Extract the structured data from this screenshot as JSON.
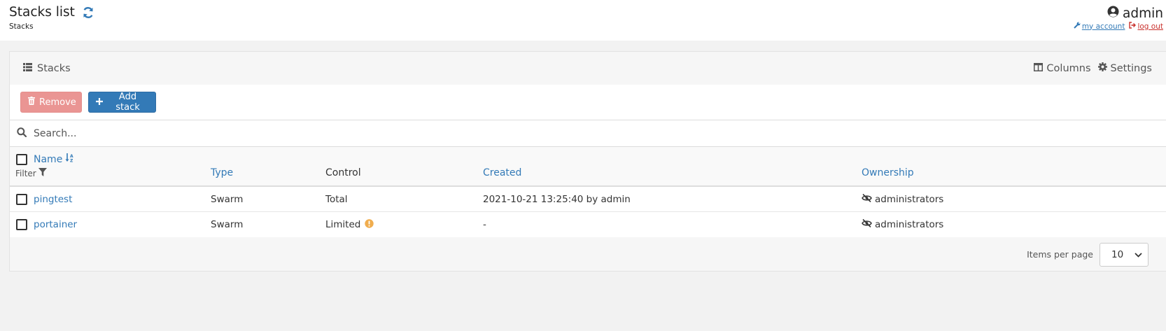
{
  "header": {
    "title": "Stacks list",
    "breadcrumb": "Stacks",
    "user": "admin",
    "my_account": "my account",
    "log_out": "log out"
  },
  "widget": {
    "title": "Stacks",
    "columns_label": "Columns",
    "settings_label": "Settings"
  },
  "toolbar": {
    "remove_label": "Remove",
    "add_label": "Add stack"
  },
  "search": {
    "placeholder": "Search..."
  },
  "table": {
    "columns": {
      "name": "Name",
      "filter": "Filter",
      "type": "Type",
      "control": "Control",
      "created": "Created",
      "ownership": "Ownership"
    },
    "rows": [
      {
        "name": "pingtest",
        "type": "Swarm",
        "control": "Total",
        "created": "2021-10-21 13:25:40 by admin",
        "ownership": "administrators"
      },
      {
        "name": "portainer",
        "type": "Swarm",
        "control": "Limited",
        "created": "-",
        "ownership": "administrators"
      }
    ]
  },
  "pagination": {
    "items_per_page_label": "Items per page",
    "items_per_page_value": "10"
  },
  "colors": {
    "accent": "#337ab7",
    "danger_light": "#ea9593",
    "warning": "#f0ad4e",
    "logout": "#c9302c"
  }
}
